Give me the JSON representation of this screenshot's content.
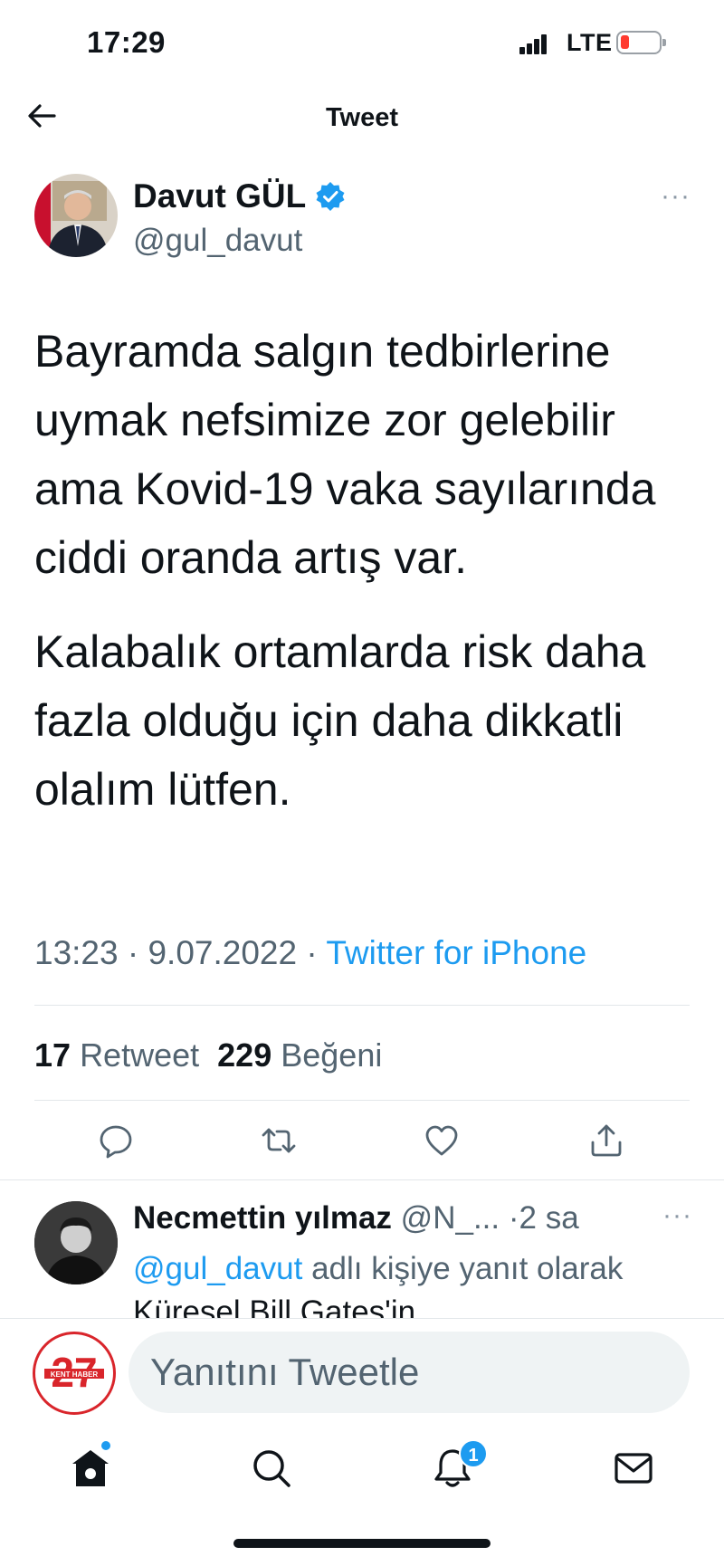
{
  "status_bar": {
    "time": "17:29",
    "network": "LTE",
    "battery_color": "#ff3b30"
  },
  "header": {
    "title": "Tweet",
    "back_icon": "arrow-left-icon"
  },
  "tweet": {
    "author_name": "Davut GÜL",
    "verified": true,
    "handle": "@gul_davut",
    "paragraphs": [
      "Bayramda salgın tedbirlerine uymak nefsimize zor gelebilir ama Kovid-19 vaka sayılarında ciddi oranda artış var.",
      "Kalabalık ortamlarda risk daha fazla olduğu için daha dikkatli olalım lütfen."
    ],
    "time": "13:23",
    "date": "9.07.2022",
    "source": "Twitter for iPhone",
    "retweet_count": "17",
    "retweet_label": "Retweet",
    "like_count": "229",
    "like_label": "Beğeni",
    "more": "···"
  },
  "reply": {
    "name": "Necmettin yılmaz",
    "handle": "@N_...",
    "age": "2 sa",
    "reply_to_mention": "@gul_davut",
    "reply_to_text": "adlı kişiye yanıt olarak",
    "truncated_text": "Küresel Bill Gates'in",
    "more": "···"
  },
  "compose": {
    "placeholder": "Yanıtını Tweetle",
    "logo_number": "27",
    "logo_text": "KENT HABER"
  },
  "tabbar": {
    "notifications_badge": "1"
  },
  "colors": {
    "accent": "#1d9bf0",
    "text": "#0f1419",
    "secondary": "#536471"
  }
}
